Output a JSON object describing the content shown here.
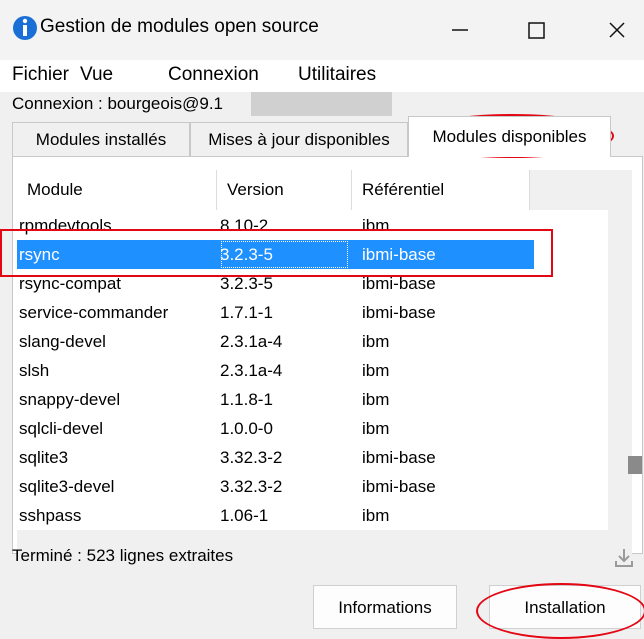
{
  "window": {
    "title": "Gestion de modules open source"
  },
  "menu": [
    "Fichier",
    "Vue",
    "Connexion",
    "Utilitaires"
  ],
  "connection": {
    "label": "Connexion : bourgeois@9.1"
  },
  "tabs": [
    {
      "label": "Modules installés",
      "active": false
    },
    {
      "label": "Mises à jour disponibles",
      "active": false
    },
    {
      "label": "Modules disponibles",
      "active": true
    }
  ],
  "table": {
    "columns": [
      "Module",
      "Version",
      "Référentiel"
    ],
    "rows": [
      {
        "module": "rpmdevtools",
        "version": "8.10-2",
        "repo": "ibm"
      },
      {
        "module": "rsync",
        "version": "3.2.3-5",
        "repo": "ibmi-base",
        "selected": true
      },
      {
        "module": "rsync-compat",
        "version": "3.2.3-5",
        "repo": "ibmi-base"
      },
      {
        "module": "service-commander",
        "version": "1.7.1-1",
        "repo": "ibmi-base"
      },
      {
        "module": "slang-devel",
        "version": "2.3.1a-4",
        "repo": "ibm"
      },
      {
        "module": "slsh",
        "version": "2.3.1a-4",
        "repo": "ibm"
      },
      {
        "module": "snappy-devel",
        "version": "1.1.8-1",
        "repo": "ibm"
      },
      {
        "module": "sqlcli-devel",
        "version": "1.0.0-0",
        "repo": "ibm"
      },
      {
        "module": "sqlite3",
        "version": "3.32.3-2",
        "repo": "ibmi-base"
      },
      {
        "module": "sqlite3-devel",
        "version": "3.32.3-2",
        "repo": "ibmi-base"
      },
      {
        "module": "sshpass",
        "version": "1.06-1",
        "repo": "ibm"
      }
    ]
  },
  "status": "Terminé : 523 lignes extraites",
  "buttons": {
    "info": "Informations",
    "install": "Installation"
  },
  "colors": {
    "selection": "#1e90ff",
    "highlight": "#e30613",
    "app_icon": "#1a6fd6"
  },
  "icons": [
    "app-info-icon",
    "minimize-icon",
    "maximize-icon",
    "close-icon",
    "download-icon"
  ]
}
